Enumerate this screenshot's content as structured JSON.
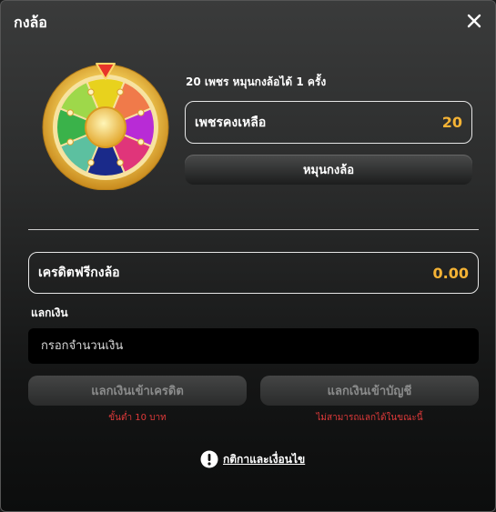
{
  "header": {
    "title": "กงล้อ",
    "close_icon": "close-icon"
  },
  "wheel": {
    "icon": "prize-wheel-icon",
    "segment_colors": [
      "#e8d21d",
      "#f07a4a",
      "#b82bd6",
      "#e0357a",
      "#1a2a8a",
      "#5cc0a0",
      "#3ab24a",
      "#9ed84a"
    ]
  },
  "spin": {
    "info": "20 เพชร หมุนกงล้อได้ 1 ครั้ง",
    "remaining_label": "เพชรคงเหลือ",
    "remaining_value": "20",
    "spin_button": "หมุนกงล้อ"
  },
  "credit": {
    "label": "เครดิตฟรีกงล้อ",
    "value": "0.00"
  },
  "exchange": {
    "section_label": "แลกเงิน",
    "amount_placeholder": "กรอกจำนวนเงิน",
    "to_credit_button": "แลกเงินเข้าเครดิต",
    "to_account_button": "แลกเงินเข้าบัญชี",
    "min_note": "ขั้นต่ำ 10 บาท",
    "unavailable_note": "ไม่สามารถแลกได้ในขณะนี้"
  },
  "terms": {
    "icon": "exclamation-circle-icon",
    "label": "กติกาและเงื่อนไข"
  },
  "colors": {
    "accent": "#f5b335",
    "error": "#e03a3a",
    "disabled_text": "#8a8b8b"
  }
}
